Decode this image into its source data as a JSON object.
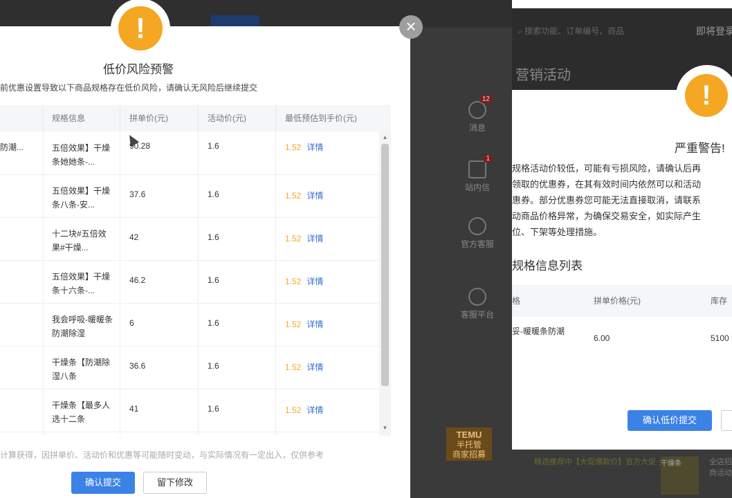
{
  "background": {
    "sidebar": [
      {
        "label": "消息",
        "badge": "12"
      },
      {
        "label": "站内信",
        "badge": "1"
      },
      {
        "label": "官方客服",
        "badge": ""
      },
      {
        "label": "客服平台",
        "badge": ""
      }
    ],
    "right_search_placeholder": "搜索功能、订单编号、商品",
    "right_link": "即将登录",
    "right_page_title": "营销活动",
    "temu_logo": "TEMU",
    "temu_sub": "半托管",
    "temu_tag": "商家招募",
    "promo_text": "精选推荐中【大促爆款价】官方大促·全店平日",
    "promo_img_label": "干燥条",
    "promo_right": "全店招商活动"
  },
  "right_dialog": {
    "title": "严重警告!",
    "lines": [
      "规格活动价较低，可能有亏损风险，请确认后再",
      "领取的优惠券，在其有效时间内依然可以和活动",
      "惠券。部分优惠券您可能无法直接取消，请联系",
      "动商品价格异常，为确保交易安全，如实际产生",
      "位、下架等处理措施。"
    ],
    "section_title": "规格信息列表",
    "columns": [
      "格",
      "拼单价格(元)",
      "库存"
    ],
    "row": {
      "spec": "妥-暖暖条防潮",
      "price": "6.00",
      "stock": "5100"
    },
    "confirm_label": "确认低价提交"
  },
  "dialog": {
    "title": "低价风险预警",
    "description": "前优惠设置导致以下商品规格存在低价风险，请确认无风险后继续提交",
    "columns": [
      "",
      "规格信息",
      "拼单价(元)",
      "活动价(元)",
      "最低预估到手价(元)"
    ],
    "rows": [
      {
        "goods": "防潮...",
        "spec": "五倍效果】干燥条她她条-...",
        "group_price": "90.28",
        "activity_price": "1.6",
        "lowest_price": "1.52",
        "detail": "详情"
      },
      {
        "goods": "",
        "spec": "五倍效果】干燥条八条-安...",
        "group_price": "37.6",
        "activity_price": "1.6",
        "lowest_price": "1.52",
        "detail": "详情"
      },
      {
        "goods": "",
        "spec": "十二块#五倍效果#干燥...",
        "group_price": "42",
        "activity_price": "1.6",
        "lowest_price": "1.52",
        "detail": "详情"
      },
      {
        "goods": "",
        "spec": "五倍效果】干燥条十六条-...",
        "group_price": "46.2",
        "activity_price": "1.6",
        "lowest_price": "1.52",
        "detail": "详情"
      },
      {
        "goods": "",
        "spec": "我会呼吸-暖暖条防潮除湿",
        "group_price": "6",
        "activity_price": "1.6",
        "lowest_price": "1.52",
        "detail": "详情"
      },
      {
        "goods": "",
        "spec": "干燥条【防潮除湿八条",
        "group_price": "36.6",
        "activity_price": "1.6",
        "lowest_price": "1.52",
        "detail": "详情"
      },
      {
        "goods": "",
        "spec": "干燥条【最多人选十二条",
        "group_price": "41",
        "activity_price": "1.6",
        "lowest_price": "1.52",
        "detail": "详情"
      }
    ],
    "footnote": "计算获得，因拼单价、活动价和优惠等可能随时变动，与实际情况有一定出入，仅供参考",
    "confirm_label": "确认提交",
    "modify_label": "留下修改",
    "close_symbol": "×",
    "warning_symbol": "!"
  },
  "colors": {
    "accent": "#3b82e6",
    "warning": "#f5a623",
    "link": "#2f6fd6"
  }
}
